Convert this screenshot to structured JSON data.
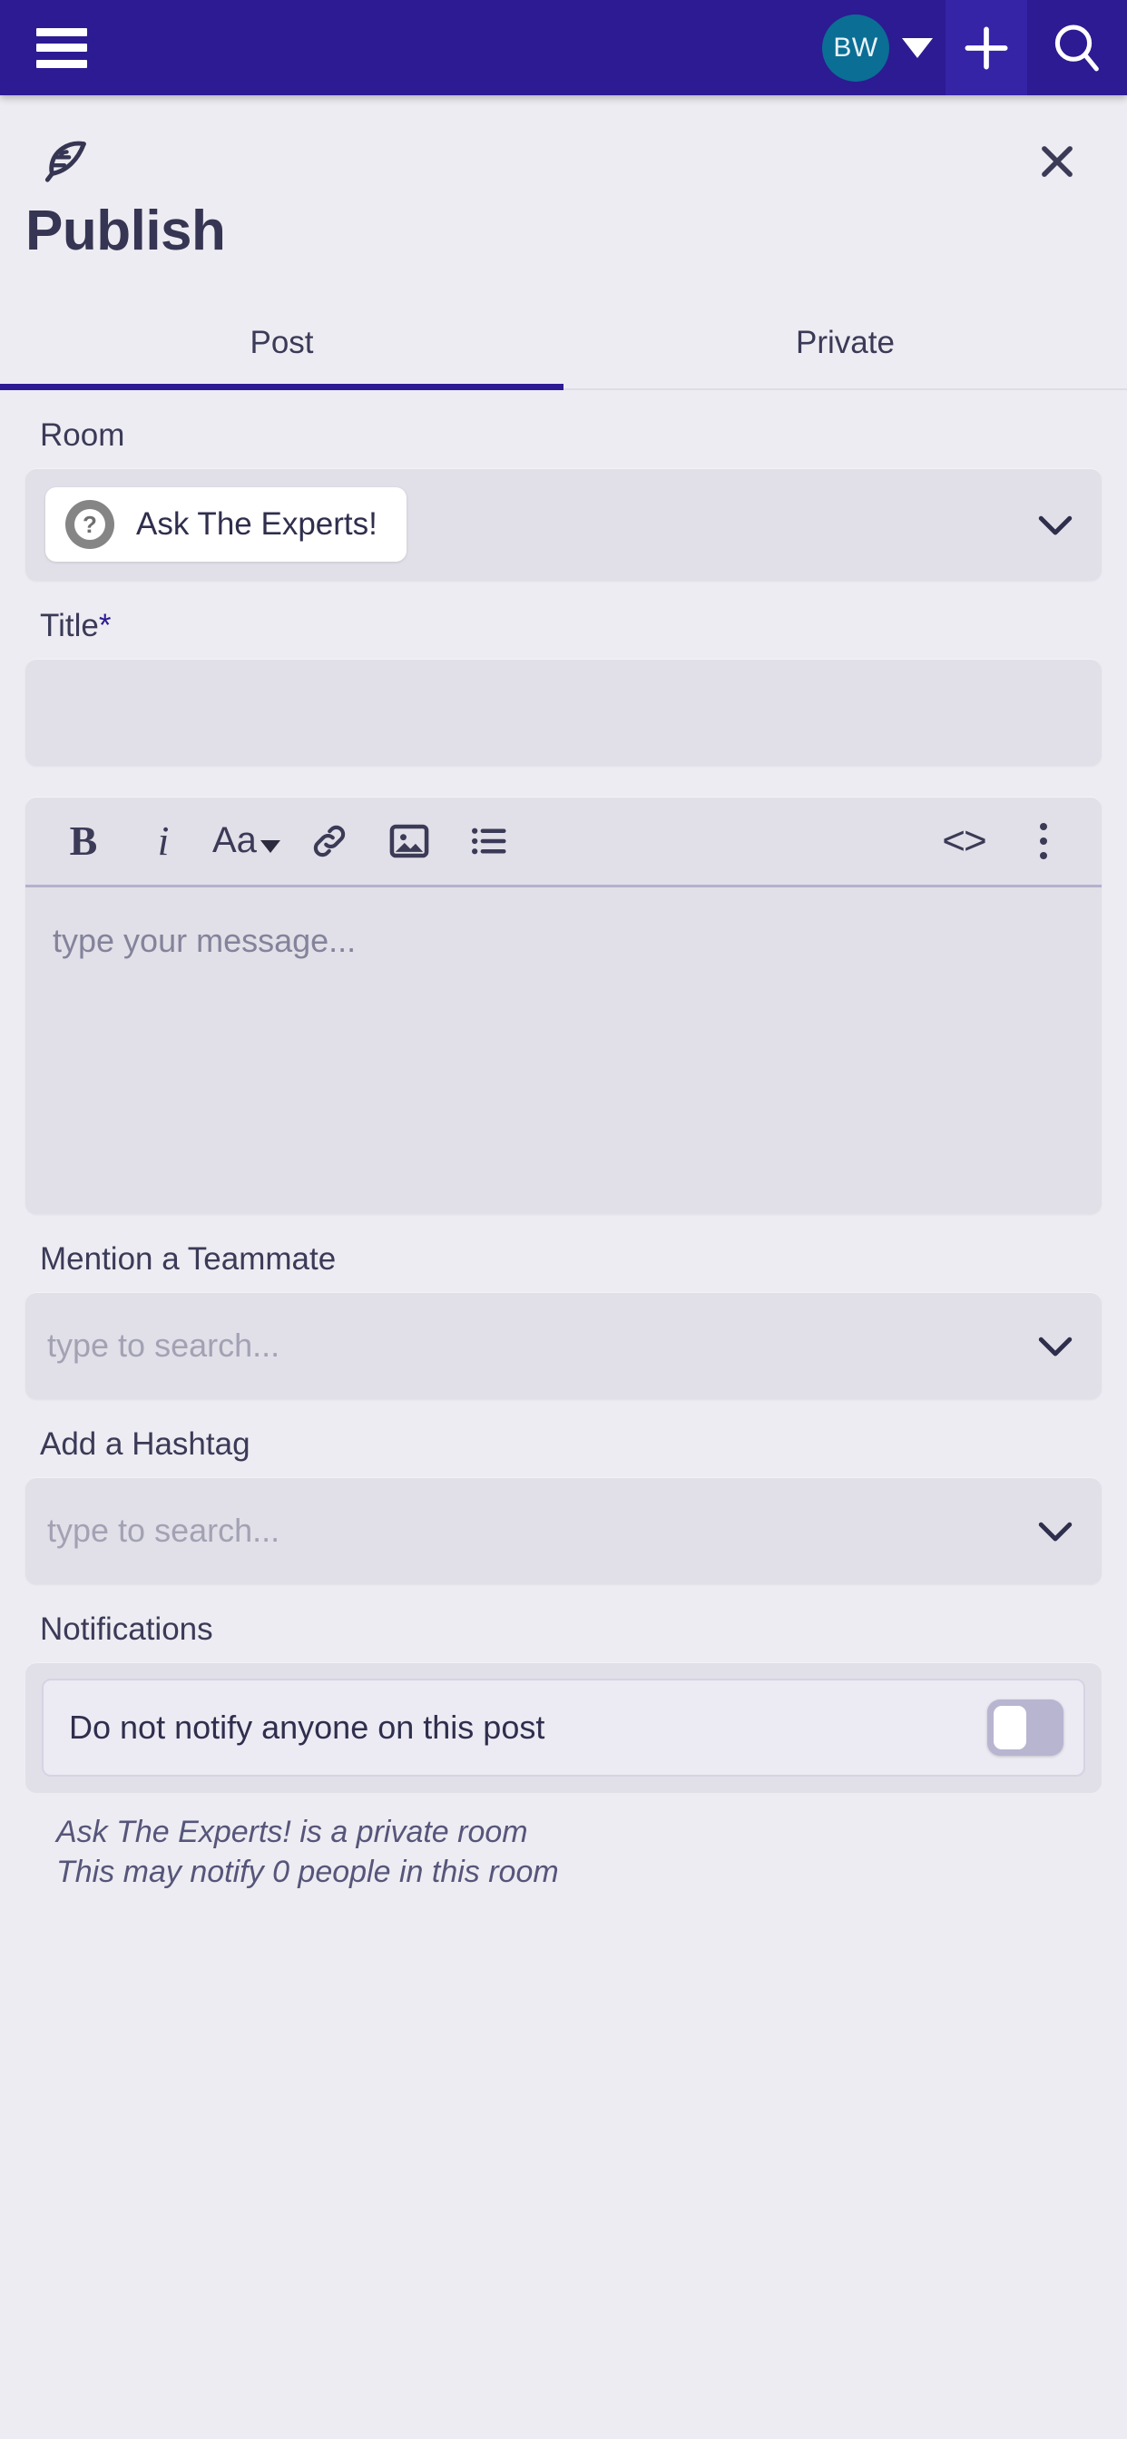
{
  "appbar": {
    "menu_icon": "hamburger-icon",
    "avatar_initials": "BW",
    "account_caret": "chevron-down-icon",
    "add_icon": "plus-icon",
    "search_icon": "search-icon"
  },
  "sheet": {
    "brand_icon": "feather-icon",
    "close_icon": "close-icon",
    "title": "Publish"
  },
  "tabs": [
    {
      "label": "Post",
      "active": true
    },
    {
      "label": "Private",
      "active": false
    }
  ],
  "form": {
    "room": {
      "label": "Room",
      "selected_icon": "question-mark-icon",
      "selected": "Ask The Experts!",
      "chevron": "chevron-down-icon"
    },
    "title": {
      "label": "Title",
      "required_marker": "*",
      "value": "",
      "placeholder": ""
    },
    "editor": {
      "tools": [
        {
          "name": "bold",
          "glyph": "B"
        },
        {
          "name": "italic",
          "glyph": "i"
        },
        {
          "name": "font-size",
          "glyph": "Aa"
        },
        {
          "name": "link",
          "glyph": "link-icon"
        },
        {
          "name": "image",
          "glyph": "image-icon"
        },
        {
          "name": "bulleted-list",
          "glyph": "list-icon"
        },
        {
          "name": "code",
          "glyph": "<>"
        },
        {
          "name": "more",
          "glyph": "more-vertical-icon"
        }
      ],
      "placeholder": "type your message..."
    },
    "mention": {
      "label": "Mention a Teammate",
      "placeholder": "type to search...",
      "value": "",
      "chevron": "chevron-down-icon"
    },
    "hashtag": {
      "label": "Add a Hashtag",
      "placeholder": "type to search...",
      "value": "",
      "chevron": "chevron-down-icon"
    },
    "notifications": {
      "label": "Notifications",
      "option_label": "Do not notify anyone on this post",
      "toggle_state": "off"
    },
    "notes": [
      "Ask The Experts! is a private room",
      "This may notify 0 people in this room"
    ]
  },
  "colors": {
    "appbar": "#2c1b92",
    "accent": "#2c1b92",
    "avatar": "#0b6e94",
    "page_bg": "#edecf2",
    "control_bg": "#e1e0e8"
  }
}
